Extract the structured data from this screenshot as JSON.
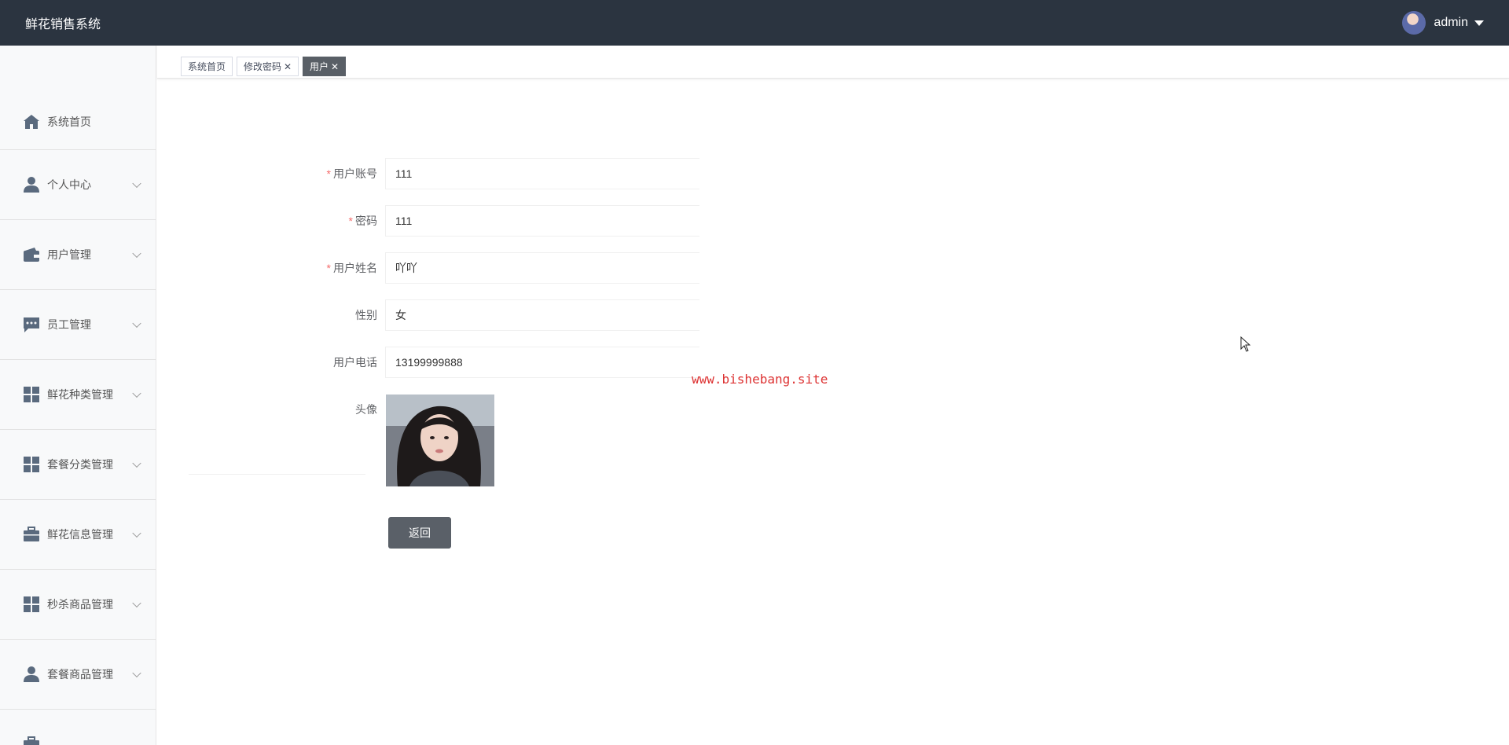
{
  "header": {
    "brand": "鲜花销售系统",
    "username": "admin"
  },
  "sidebar": {
    "items": [
      {
        "label": "系统首页",
        "icon": "home-icon",
        "expandable": false
      },
      {
        "label": "个人中心",
        "icon": "person-icon",
        "expandable": true
      },
      {
        "label": "用户管理",
        "icon": "wallet-icon",
        "expandable": true
      },
      {
        "label": "员工管理",
        "icon": "chat-icon",
        "expandable": true
      },
      {
        "label": "鲜花种类管理",
        "icon": "grid-icon",
        "expandable": true
      },
      {
        "label": "套餐分类管理",
        "icon": "grid-icon",
        "expandable": true
      },
      {
        "label": "鲜花信息管理",
        "icon": "briefcase-icon",
        "expandable": true
      },
      {
        "label": "秒杀商品管理",
        "icon": "grid-icon",
        "expandable": true
      },
      {
        "label": "套餐商品管理",
        "icon": "person-icon",
        "expandable": true
      },
      {
        "label": "",
        "icon": "briefcase-icon",
        "expandable": false
      }
    ]
  },
  "tabs": [
    {
      "label": "系统首页",
      "closable": false,
      "active": false
    },
    {
      "label": "修改密码",
      "closable": true,
      "active": false
    },
    {
      "label": "用户",
      "closable": true,
      "active": true
    }
  ],
  "form": {
    "fields": [
      {
        "label": "用户账号",
        "required": true,
        "value": "111"
      },
      {
        "label": "密码",
        "required": true,
        "value": "111"
      },
      {
        "label": "用户姓名",
        "required": true,
        "value": "吖吖"
      },
      {
        "label": "性别",
        "required": false,
        "value": "女"
      },
      {
        "label": "用户电话",
        "required": false,
        "value": "13199999888"
      }
    ],
    "avatar_label": "头像",
    "back_button": "返回"
  },
  "watermark": "www.bishebang.site",
  "colors": {
    "topbar": "#2b3440",
    "sidebar_bg": "#f8f9fa",
    "active_tab": "#595f66",
    "required_star": "#f56c6c",
    "watermark": "#dd3333"
  }
}
